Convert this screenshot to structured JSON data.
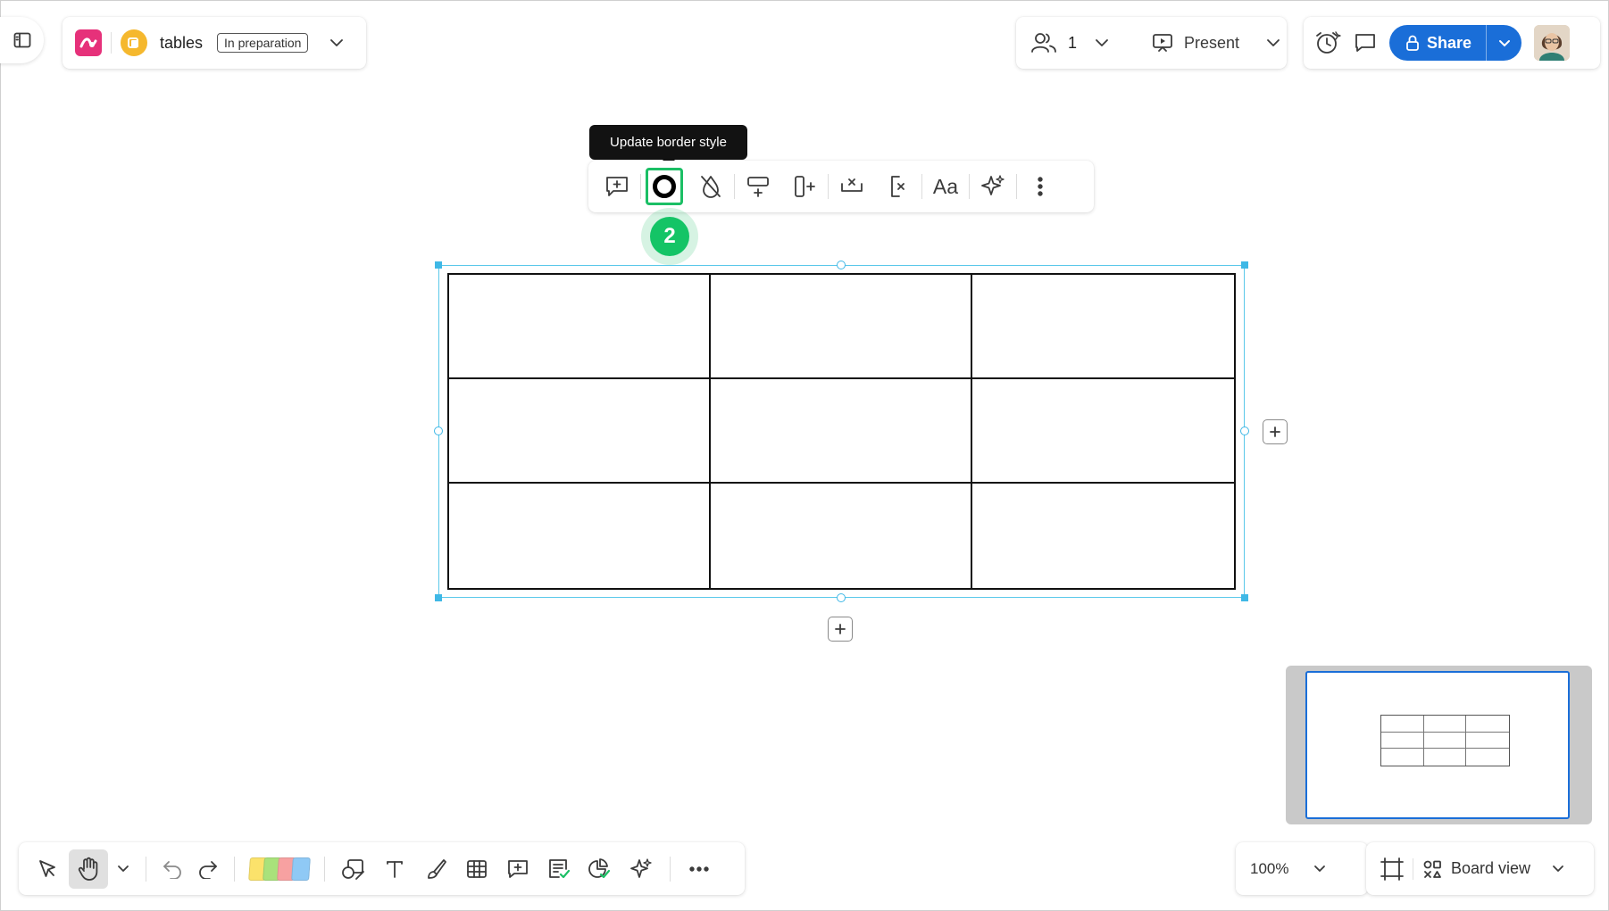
{
  "header": {
    "board_name": "tables",
    "status_badge": "In preparation"
  },
  "collaboration": {
    "participant_count": "1",
    "present_label": "Present"
  },
  "share": {
    "label": "Share"
  },
  "context_toolbar": {
    "tooltip": "Update border style",
    "items": [
      "add-comment",
      "border-style",
      "fill-color",
      "add-row",
      "add-column",
      "delete-row",
      "delete-column",
      "text-format",
      "ai-assist",
      "more-options"
    ],
    "active_item": "border-style"
  },
  "step_badge": "2",
  "table": {
    "rows": 3,
    "columns": 3,
    "cells": [
      [
        "",
        "",
        ""
      ],
      [
        "",
        "",
        ""
      ],
      [
        "",
        "",
        ""
      ]
    ]
  },
  "bottom_toolbar": {
    "tools": [
      "select",
      "hand",
      "undo",
      "redo",
      "sticky-notes",
      "shapes",
      "text",
      "pen",
      "table",
      "comment",
      "card",
      "diagram",
      "ai",
      "more"
    ],
    "selected_tool": "hand",
    "sticky_colors": [
      "#fbe26b",
      "#a9e27b",
      "#f7a1a1",
      "#8fc9f5"
    ]
  },
  "zoom": {
    "level": "100%"
  },
  "view": {
    "label": "Board view"
  },
  "colors": {
    "accent": "#1a6ed8",
    "selection": "#3fb8e6",
    "highlight": "#1bbf65",
    "logo": "#e6317a",
    "board_icon": "#f5b82e"
  }
}
